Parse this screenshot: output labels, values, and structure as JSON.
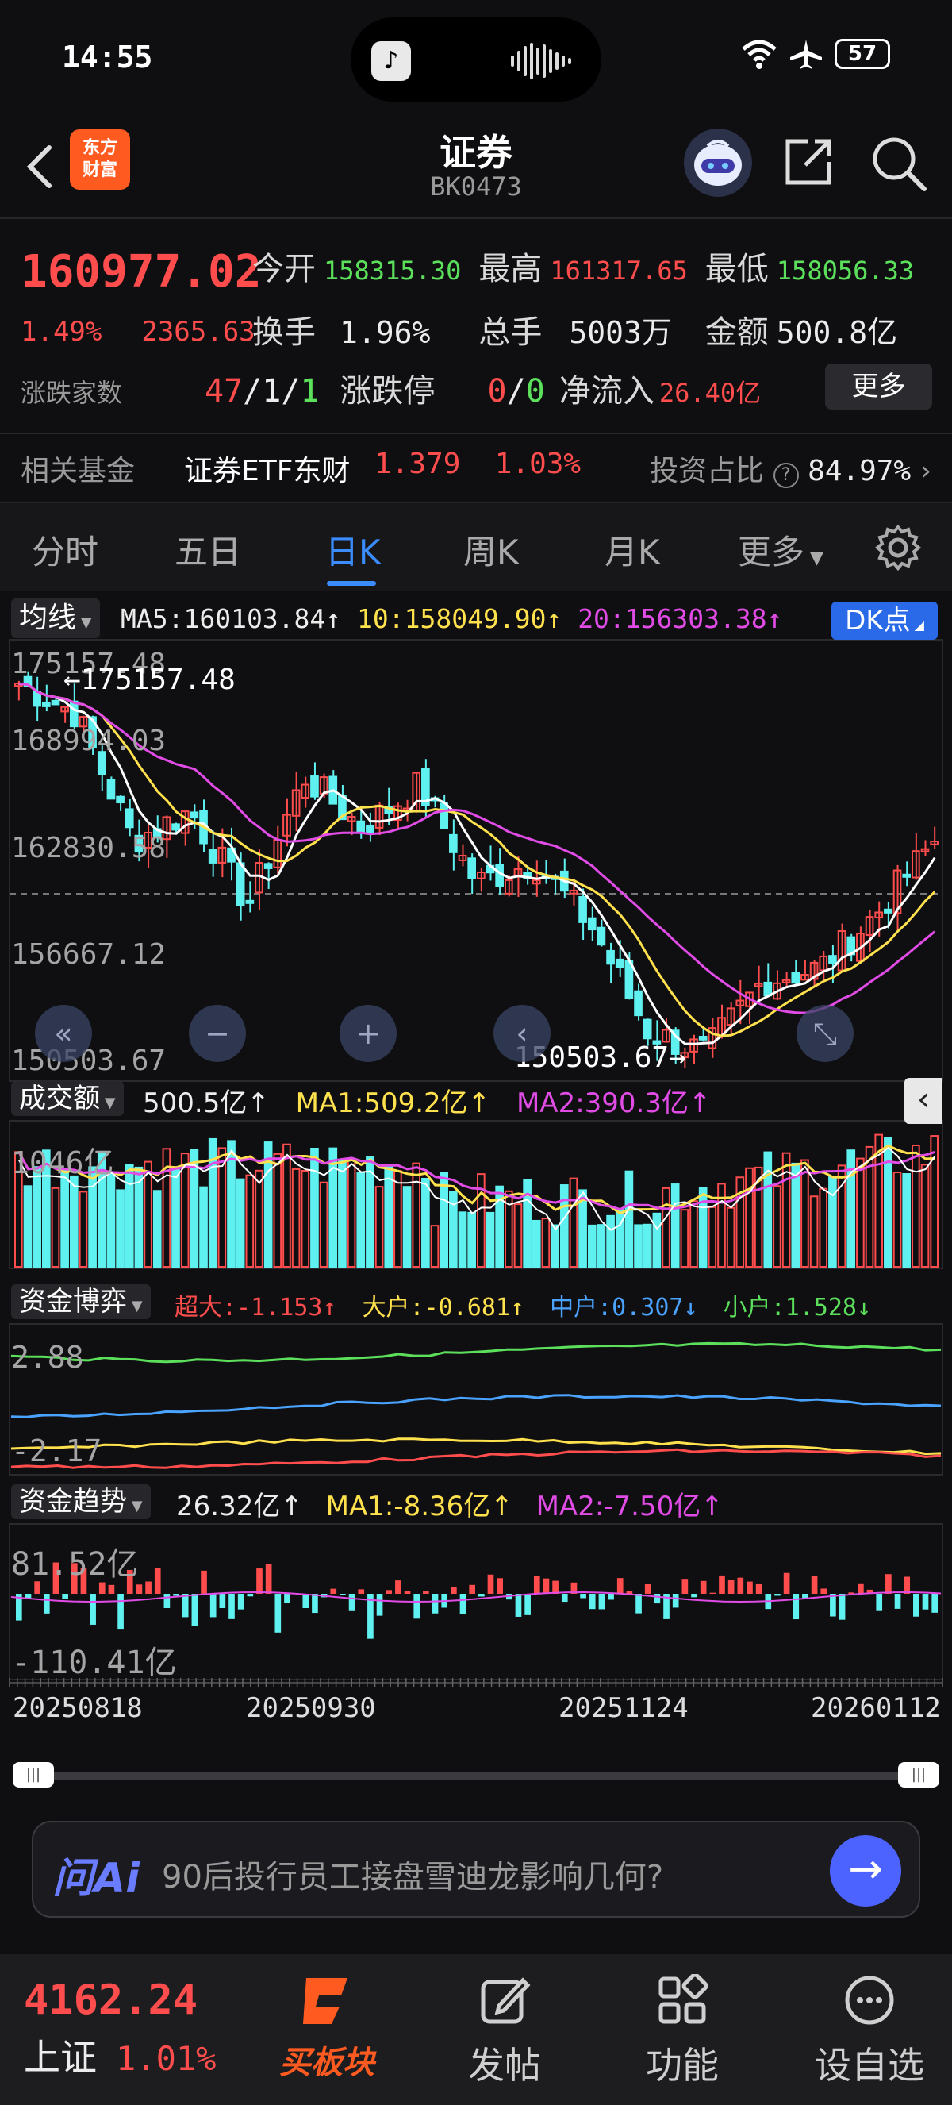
{
  "status_bar": {
    "time": "14:55",
    "battery": "57"
  },
  "header": {
    "logo_text": "东方\n财富",
    "title": "证券",
    "code": "BK0473"
  },
  "quote": {
    "price": "160977.02",
    "change_pct": "1.49%",
    "change_amt": "2365.63",
    "open_label": "今开",
    "open": "158315.30",
    "high_label": "最高",
    "high": "161317.65",
    "low_label": "最低",
    "low": "158056.33",
    "turnover_label": "换手",
    "turnover": "1.96%",
    "volume_label": "总手",
    "volume": "5003万",
    "amount_label": "金额",
    "amount": "500.8亿",
    "updown_label": "涨跌家数",
    "up": "47",
    "flat": "1",
    "down": "1",
    "limit_label": "涨跌停",
    "limit_up": "0",
    "limit_down": "0",
    "netflow_label": "净流入",
    "netflow": "26.40亿",
    "more": "更多"
  },
  "fund": {
    "label": "相关基金",
    "name": "证券ETF东财",
    "price": "1.379",
    "pct": "1.03%",
    "ratio_label": "投资占比",
    "ratio": "84.97%"
  },
  "tabs": [
    "分时",
    "五日",
    "日K",
    "周K",
    "月K",
    "更多"
  ],
  "active_tab": "日K",
  "kline": {
    "ma_label": "均线",
    "ma5": "MA5:160103.84↑",
    "ma10": "10:158049.90↑",
    "ma20": "20:156303.38↑",
    "dk_label": "DK点",
    "y_labels": [
      "175157.48",
      "168994.03",
      "162830.58",
      "156667.12",
      "150503.67"
    ],
    "max_marker": "←175157.48",
    "min_marker": "150503.67→",
    "volume_label": "成交额",
    "volume_val": "500.5亿↑",
    "volume_ma1": "MA1:509.2亿↑",
    "volume_ma2": "MA2:390.3亿↑",
    "volume_max": "1046亿",
    "game_label": "资金博弈",
    "game_super": "超大:-1.153↑",
    "game_big": "大户:-0.681↑",
    "game_mid": "中户:0.307↓",
    "game_small": "小户:1.528↓",
    "game_max": "2.88",
    "game_min": "-2.17",
    "trend_label": "资金趋势",
    "trend_val": "26.32亿↑",
    "trend_ma1": "MA1:-8.36亿↑",
    "trend_ma2": "MA2:-7.50亿↑",
    "trend_max": "81.52亿",
    "trend_min": "-110.41亿",
    "dates": [
      "20250818",
      "20250930",
      "20251124",
      "20260112"
    ]
  },
  "ai": {
    "logo": "问Ai",
    "prompt": "90后投行员工接盘雪迪龙影响几何?"
  },
  "bottom": {
    "index_value": "4162.24",
    "index_name": "上证",
    "index_pct": "1.01%",
    "nav": [
      "买板块",
      "发帖",
      "功能",
      "设自选"
    ]
  },
  "colors": {
    "up": "#ff4d4d",
    "down": "#5ff0f0",
    "accent": "#3b8cff",
    "ma5": "#ffffff",
    "ma10": "#ffe14d",
    "ma20": "#e14ce6"
  }
}
